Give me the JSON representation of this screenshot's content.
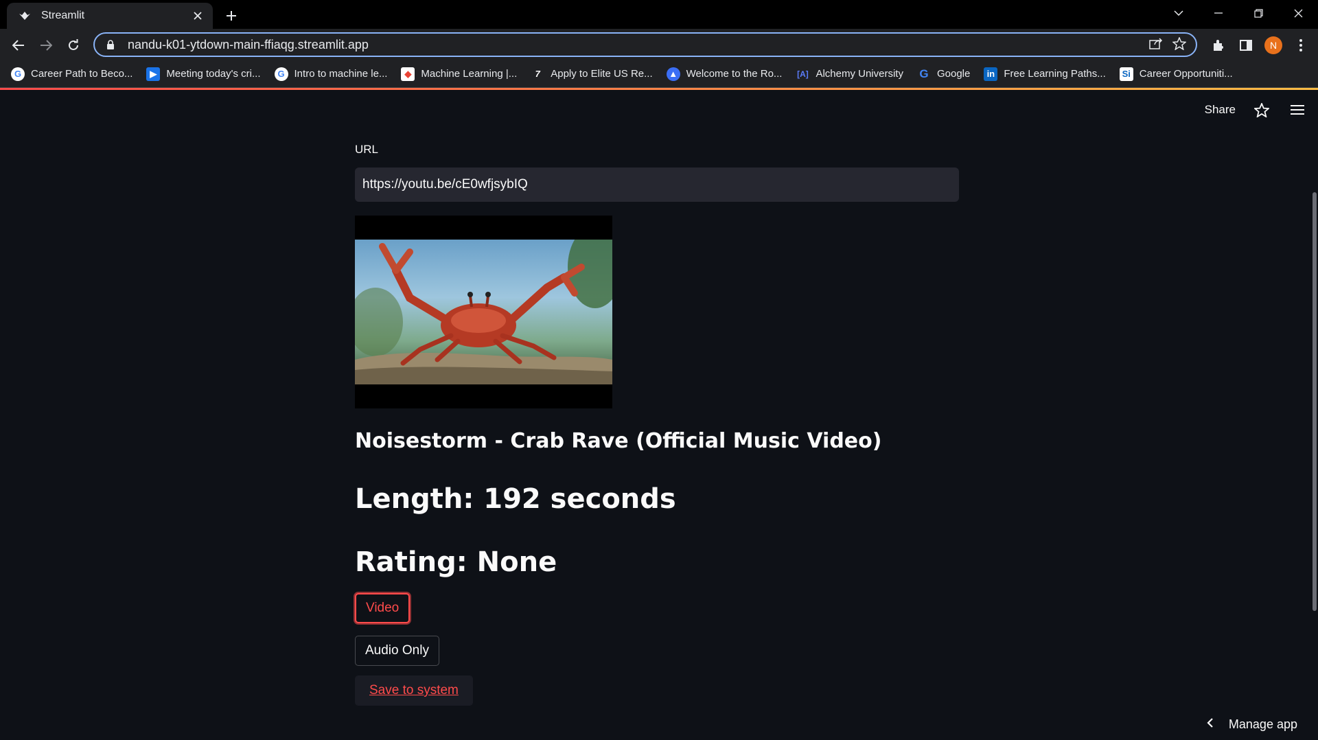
{
  "browser": {
    "tab_title": "Streamlit",
    "url": "nandu-k01-ytdown-main-ffiaqg.streamlit.app",
    "profile_initial": "N",
    "bookmarks": [
      {
        "icon": "google-icon",
        "label": "Career Path to Beco..."
      },
      {
        "icon": "meeting-icon",
        "label": "Meeting today's cri..."
      },
      {
        "icon": "google-icon",
        "label": "Intro to machine le..."
      },
      {
        "icon": "ml-icon",
        "label": "Machine Learning |..."
      },
      {
        "icon": "seven-icon",
        "label": "Apply to Elite US Re..."
      },
      {
        "icon": "triangle-icon",
        "label": "Welcome to the Ro..."
      },
      {
        "icon": "alchemy-icon",
        "label": "Alchemy University"
      },
      {
        "icon": "google-icon",
        "label": "Google"
      },
      {
        "icon": "linkedin-icon",
        "label": "Free Learning Paths..."
      },
      {
        "icon": "careers-icon",
        "label": "Career Opportuniti..."
      }
    ]
  },
  "header": {
    "share_label": "Share"
  },
  "form": {
    "url_label": "URL",
    "url_value": "https://youtu.be/cE0wfjsybIQ"
  },
  "video": {
    "title": "Noisestorm - Crab Rave (Official Music Video)",
    "length": "Length: 192 seconds",
    "rating": "Rating: None"
  },
  "buttons": {
    "video": "Video",
    "audio_only": "Audio Only",
    "save": "Save to system"
  },
  "footer": {
    "manage_app": "Manage app"
  },
  "colors": {
    "accent": "#ff4b4b",
    "background": "#0e1117",
    "input_bg": "#262730"
  }
}
